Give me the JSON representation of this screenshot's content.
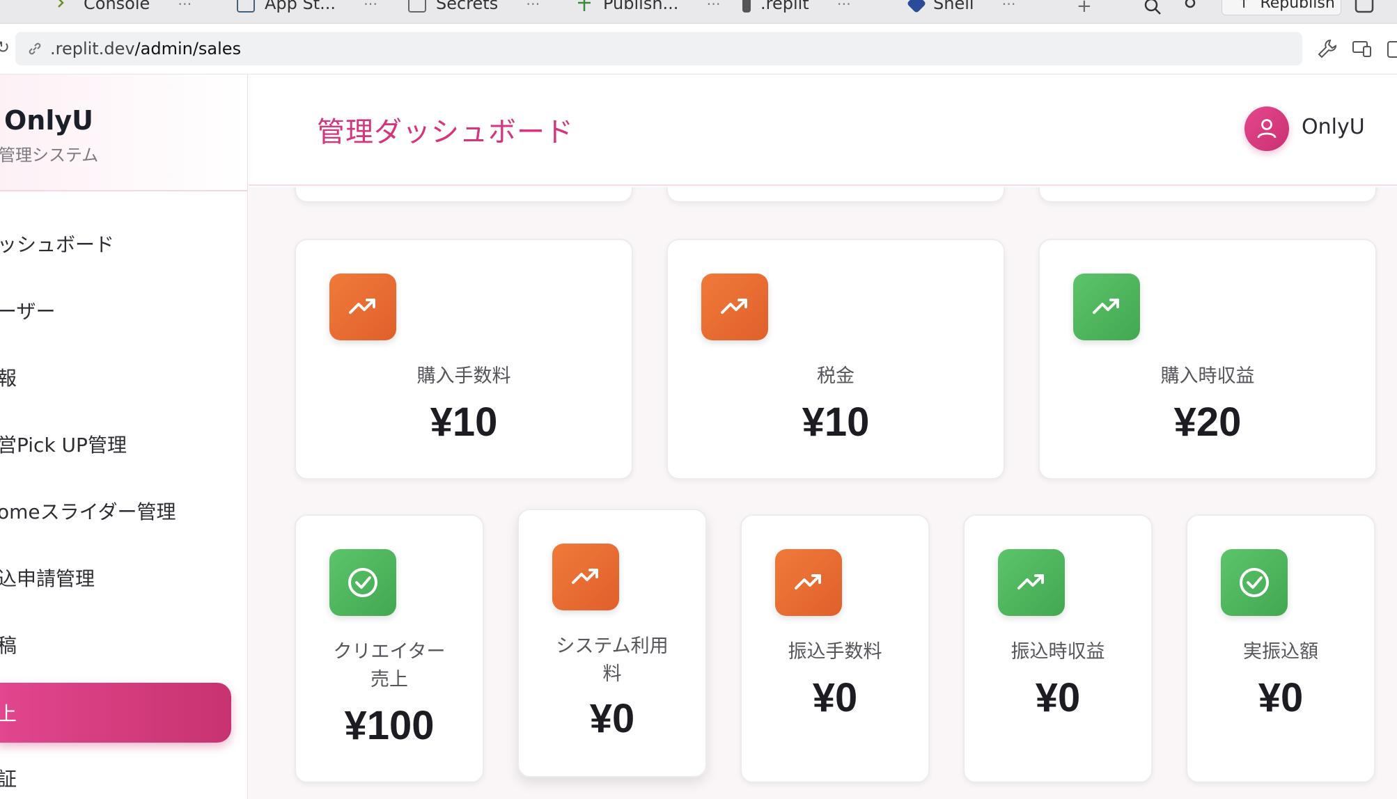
{
  "browser": {
    "tabs": [
      {
        "label": "Console"
      },
      {
        "label": "App St..."
      },
      {
        "label": "Secrets"
      },
      {
        "label": "Publish..."
      },
      {
        "label": ".replit"
      },
      {
        "label": "Shell"
      }
    ],
    "republish_label": "Republish",
    "url_host": ".replit.dev",
    "url_path": "/admin/sales"
  },
  "sidebar": {
    "brand_name": "OnlyU",
    "brand_sub": "管理システム",
    "items": [
      {
        "label": "ッシュボード"
      },
      {
        "label": "ーザー"
      },
      {
        "label": "報"
      },
      {
        "label": "営Pick UP管理"
      },
      {
        "label": "omeスライダー管理"
      },
      {
        "label": "込申請管理"
      },
      {
        "label": "稿"
      },
      {
        "label": "上"
      },
      {
        "label": "証"
      }
    ]
  },
  "header": {
    "title": "管理ダッシュボード",
    "user_name": "OnlyU"
  },
  "colors": {
    "accent": "#d6347d",
    "orange": "#e96a30",
    "green": "#4db85c"
  },
  "stats_row1": [
    {
      "label": "購入手数料",
      "value": "¥10",
      "icon": "trending-up-icon",
      "color": "orange"
    },
    {
      "label": "税金",
      "value": "¥10",
      "icon": "trending-up-icon",
      "color": "orange"
    },
    {
      "label": "購入時収益",
      "value": "¥20",
      "icon": "trending-up-icon",
      "color": "green"
    }
  ],
  "stats_row2": [
    {
      "label_line1": "クリエイター",
      "label_line2": "売上",
      "value": "¥100",
      "icon": "check-circle-icon",
      "color": "green"
    },
    {
      "label_line1": "システム利用",
      "label_line2": "料",
      "value": "¥0",
      "icon": "trending-up-icon",
      "color": "orange"
    },
    {
      "label_line1": "振込手数料",
      "label_line2": "",
      "value": "¥0",
      "icon": "trending-up-icon",
      "color": "orange"
    },
    {
      "label_line1": "振込時収益",
      "label_line2": "",
      "value": "¥0",
      "icon": "trending-up-icon",
      "color": "green"
    },
    {
      "label_line1": "実振込額",
      "label_line2": "",
      "value": "¥0",
      "icon": "check-circle-icon",
      "color": "green"
    }
  ]
}
